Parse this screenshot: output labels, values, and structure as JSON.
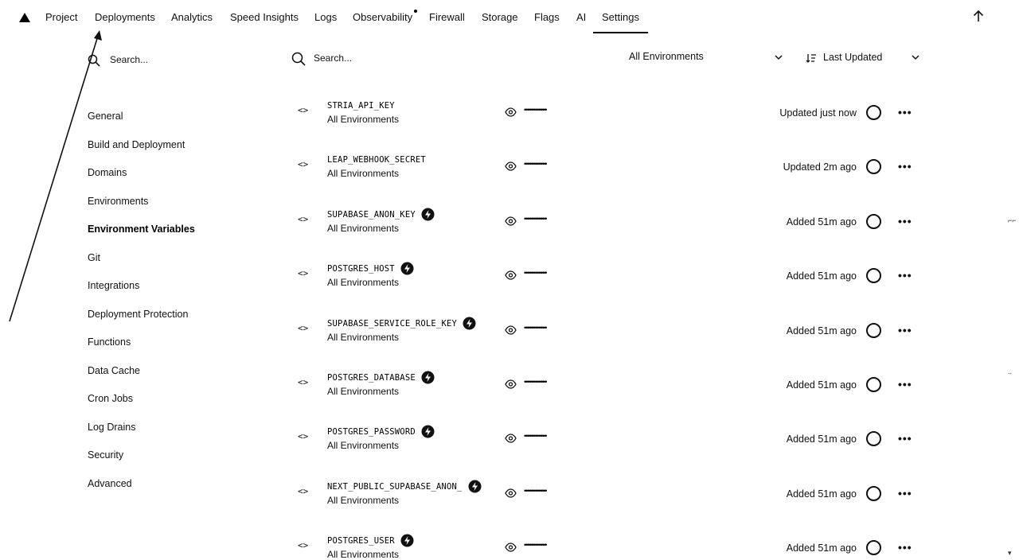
{
  "topnav": {
    "items": [
      {
        "label": "Project"
      },
      {
        "label": "Deployments"
      },
      {
        "label": "Analytics"
      },
      {
        "label": "Speed Insights"
      },
      {
        "label": "Logs"
      },
      {
        "label": "Observability"
      },
      {
        "label": "Firewall"
      },
      {
        "label": "Storage"
      },
      {
        "label": "Flags"
      },
      {
        "label": "AI"
      },
      {
        "label": "Settings"
      }
    ],
    "active": "Settings"
  },
  "sidebar": {
    "search_placeholder": "Search...",
    "items": [
      {
        "label": "General"
      },
      {
        "label": "Build and Deployment"
      },
      {
        "label": "Domains"
      },
      {
        "label": "Environments"
      },
      {
        "label": "Environment Variables"
      },
      {
        "label": "Git"
      },
      {
        "label": "Integrations"
      },
      {
        "label": "Deployment Protection"
      },
      {
        "label": "Functions"
      },
      {
        "label": "Data Cache"
      },
      {
        "label": "Cron Jobs"
      },
      {
        "label": "Log Drains"
      },
      {
        "label": "Security"
      },
      {
        "label": "Advanced"
      }
    ],
    "active": "Environment Variables"
  },
  "toolbar": {
    "search_placeholder": "Search...",
    "environment_filter": "All Environments",
    "sort_label": "Last Updated"
  },
  "variables": [
    {
      "name": "STRIA_API_KEY",
      "scope": "All Environments",
      "masked": "••••••••••••••••",
      "updated": "Updated just now",
      "integration": false
    },
    {
      "name": "LEAP_WEBHOOK_SECRET",
      "scope": "All Environments",
      "masked": "••••••••••••••••",
      "updated": "Updated 2m ago",
      "integration": false
    },
    {
      "name": "SUPABASE_ANON_KEY",
      "scope": "All Environments",
      "masked": "••••••••••••••••",
      "updated": "Added 51m ago",
      "integration": true
    },
    {
      "name": "POSTGRES_HOST",
      "scope": "All Environments",
      "masked": "••••••••••••••••",
      "updated": "Added 51m ago",
      "integration": true
    },
    {
      "name": "SUPABASE_SERVICE_ROLE_KEY",
      "scope": "All Environments",
      "masked": "••••••••••••••••",
      "updated": "Added 51m ago",
      "integration": true
    },
    {
      "name": "POSTGRES_DATABASE",
      "scope": "All Environments",
      "masked": "••••••••••••••••",
      "updated": "Added 51m ago",
      "integration": true
    },
    {
      "name": "POSTGRES_PASSWORD",
      "scope": "All Environments",
      "masked": "••••••••••••••••",
      "updated": "Added 51m ago",
      "integration": true
    },
    {
      "name": "NEXT_PUBLIC_SUPABASE_ANON_",
      "scope": "All Environments",
      "masked": "••••••••••••••••",
      "updated": "Added 51m ago",
      "integration": true
    },
    {
      "name": "POSTGRES_USER",
      "scope": "All Environments",
      "masked": "••••••••••••••••",
      "updated": "Added 51m ago",
      "integration": true
    }
  ],
  "icons": {
    "logo": "triangle-logo-icon",
    "search": "search-icon",
    "code": "code-brackets-icon",
    "eye": "eye-icon",
    "integration": "supabase-bolt-icon",
    "more": "more-horizontal-icon",
    "sort": "sort-icon",
    "chevron": "chevron-down-icon",
    "arrow_up": "arrow-up-icon"
  }
}
